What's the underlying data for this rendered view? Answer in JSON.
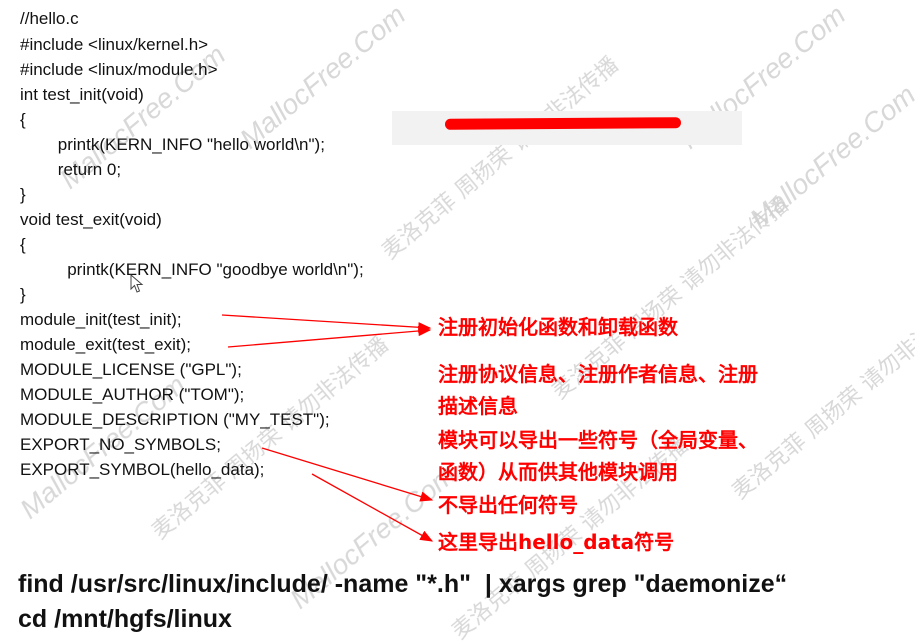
{
  "code": {
    "lines": [
      "//hello.c",
      "#include <linux/kernel.h>",
      "#include <linux/module.h>",
      "int test_init(void)",
      "{",
      "        printk(KERN_INFO \"hello world\\n\");",
      "        return 0;",
      "}",
      "void test_exit(void)",
      "{",
      "          printk(KERN_INFO \"goodbye world\\n\");",
      "}",
      "module_init(test_init);",
      "module_exit(test_exit);",
      "MODULE_LICENSE (\"GPL\");",
      "MODULE_AUTHOR (\"TOM\");",
      "MODULE_DESCRIPTION (\"MY_TEST\");",
      "EXPORT_NO_SYMBOLS;",
      "EXPORT_SYMBOL(hello_data);"
    ]
  },
  "annotations": {
    "register_init_exit": "注册初始化函数和卸载函数",
    "register_info_line1": "注册协议信息、注册作者信息、注册",
    "register_info_line2": "描述信息",
    "export_line1": "模块可以导出一些符号（全局变量、",
    "export_line2": "函数）从而供其他模块调用",
    "no_export": "不导出任何符号",
    "export_hello_data": "这里导出hello_data符号"
  },
  "commands": {
    "find_cmd": "find /usr/src/linux/include/ -name \"*.h\"  | xargs grep \"daemonize“",
    "cd_cmd": "cd /mnt/hgfs/linux"
  },
  "watermark": {
    "english": "MallocFree.Com",
    "chinese": "麦洛克菲 周扬荣 请勿非法传播"
  },
  "colors": {
    "annotation": "#ff0000",
    "code": "#111111",
    "watermark": "#c8c8c8"
  }
}
